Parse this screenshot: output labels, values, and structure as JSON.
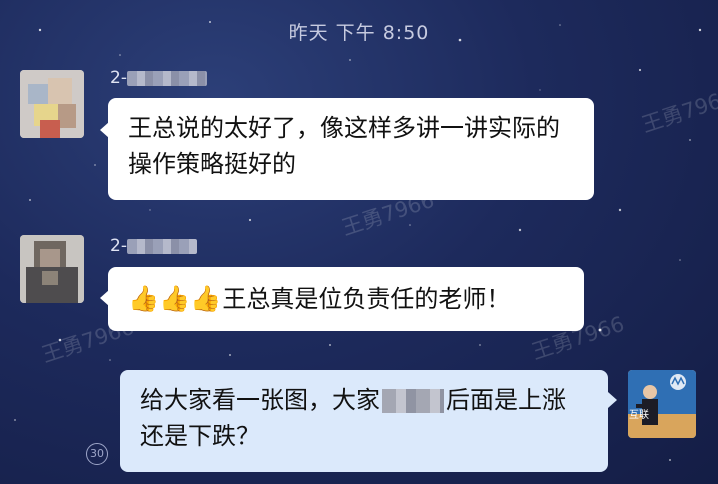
{
  "chat": {
    "timestamp": "昨天 下午 8:50",
    "messages": [
      {
        "sender_prefix": "2-",
        "text": "王总说的太好了，像这样多讲一讲实际的操作策略挺好的"
      },
      {
        "sender_prefix": "2-",
        "emoji": "👍👍👍",
        "text": "王总真是位负责任的老师！"
      },
      {
        "text_before": "给大家看一张图，大家",
        "text_after": "后面是上涨还是下跌？"
      }
    ],
    "avatar_me_caption": "互联"
  },
  "watermark": "王勇7966",
  "counter": "30"
}
